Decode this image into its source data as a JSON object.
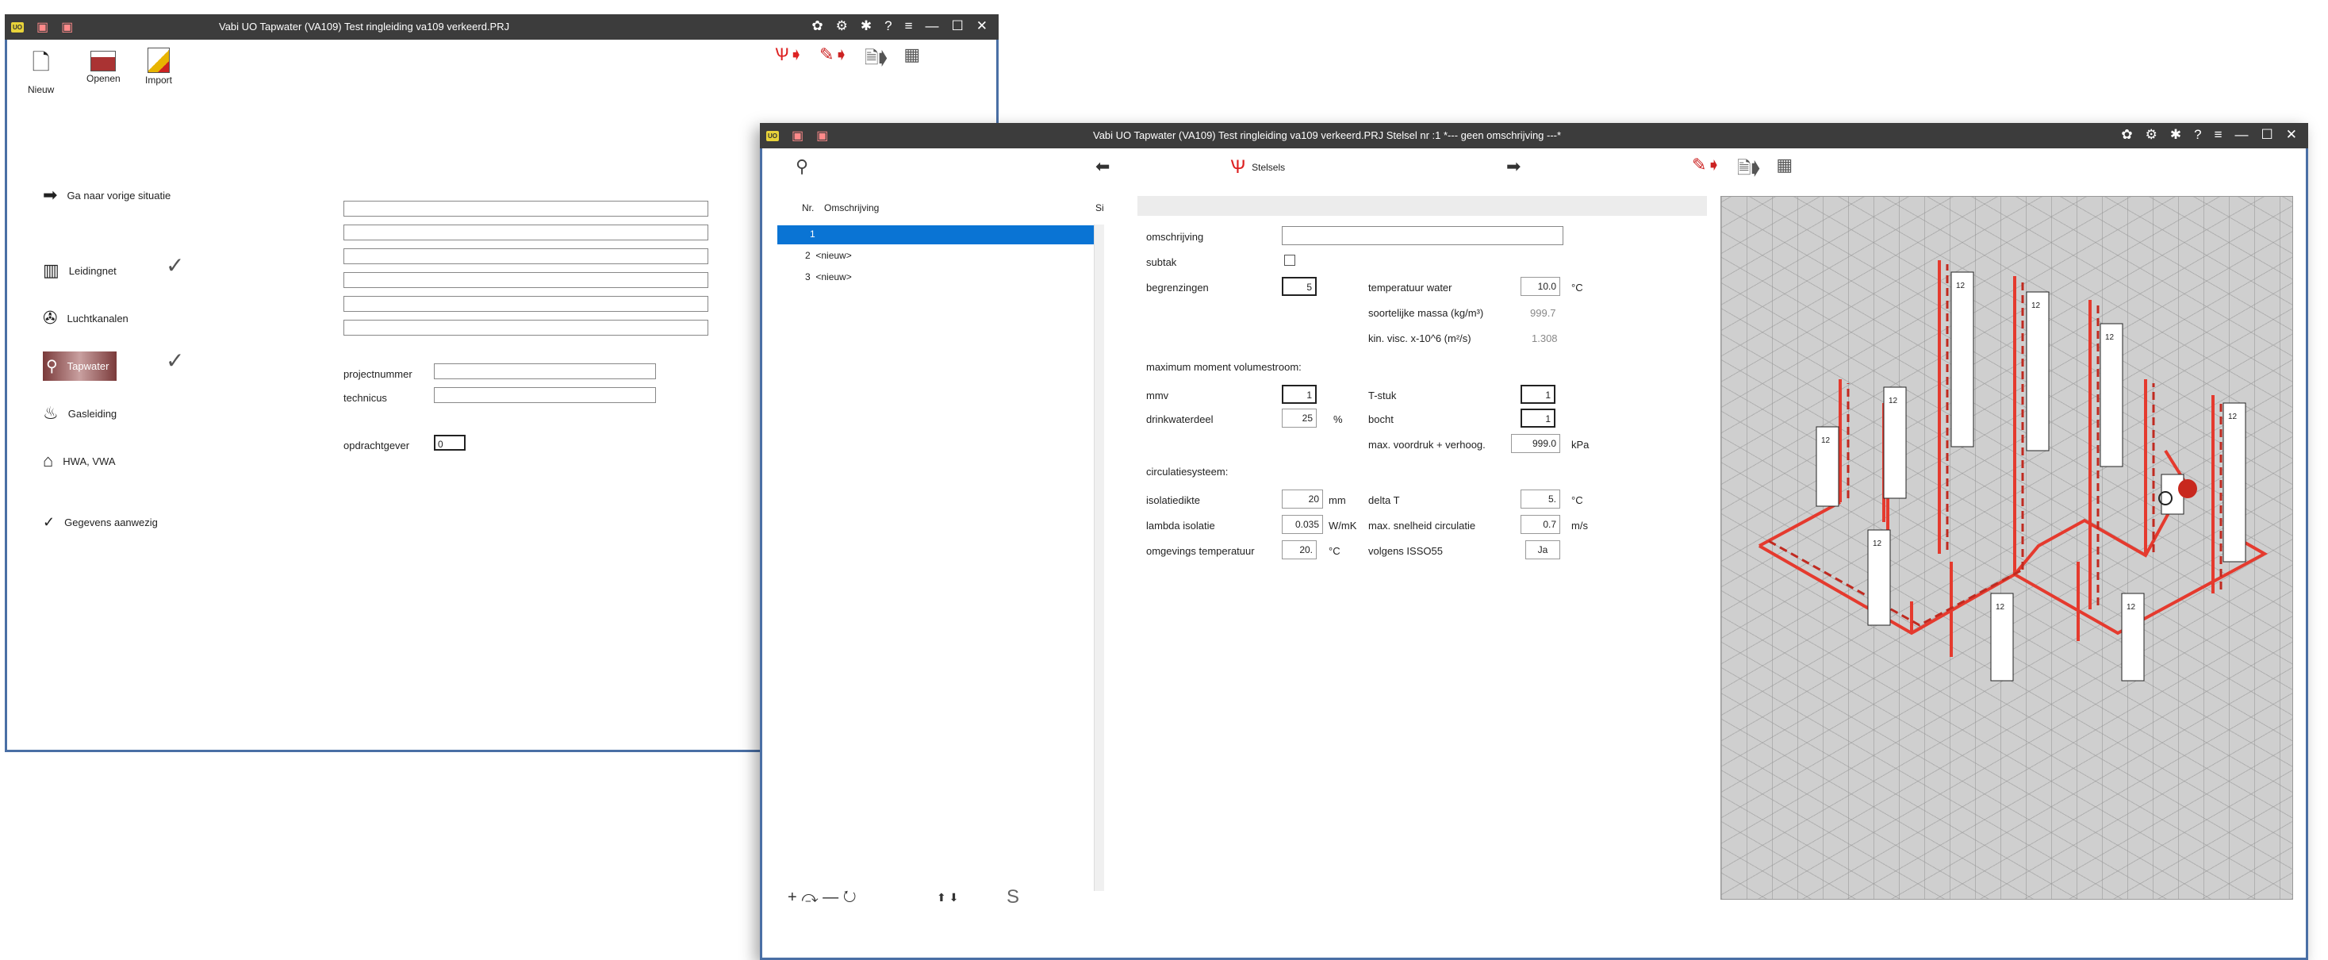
{
  "win1": {
    "title": "Vabi UO Tapwater (VA109)  Test ringleiding va109 verkeerd.PRJ",
    "toolbar": {
      "new": "Nieuw",
      "open": "Openen",
      "import": "Import"
    },
    "prev_situation": "Ga naar vorige situatie",
    "modules": [
      {
        "label": "Leidingnet",
        "checked": true,
        "icon": "radiator-icon"
      },
      {
        "label": "Luchtkanalen",
        "checked": false,
        "icon": "fan-icon"
      },
      {
        "label": "Tapwater",
        "checked": true,
        "icon": "tap-icon"
      },
      {
        "label": "Gasleiding",
        "checked": false,
        "icon": "flame-icon"
      },
      {
        "label": "HWA, VWA",
        "checked": false,
        "icon": "toilet-icon"
      }
    ],
    "data_present": "Gegevens aanwezig",
    "projectnummer_label": "projectnummer",
    "technicus_label": "technicus",
    "opdrachtgever_label": "opdrachtgever",
    "opdrachtgever_value": "0"
  },
  "win2": {
    "title": "Vabi UO Tapwater (VA109)  Test ringleiding va109 verkeerd.PRJ     Stelsel nr  :1  *--- geen omschrijving ---*",
    "tab_label": "Stelsels",
    "list": {
      "col_nr": "Nr.",
      "col_desc": "Omschrijving",
      "col_s": "Si",
      "rows": [
        {
          "nr": "1",
          "desc": ""
        },
        {
          "nr": "2",
          "desc": "<nieuw>"
        },
        {
          "nr": "3",
          "desc": "<nieuw>"
        }
      ]
    },
    "form": {
      "omschrijving_label": "omschrijving",
      "subtak_label": "subtak",
      "begrenzingen_label": "begrenzingen",
      "begrenzingen_value": "5",
      "temp_water_label": "temperatuur water",
      "temp_water_value": "10.0",
      "temp_water_unit": "°C",
      "soort_massa_label": "soortelijke massa (kg/m³)",
      "soort_massa_value": "999.7",
      "kin_visc_label": "kin. visc. x-10^6 (m²/s)",
      "kin_visc_value": "1.308",
      "max_moment_label": "maximum moment volumestroom:",
      "mmv_label": "mmv",
      "mmv_value": "1",
      "tstuk_label": "T-stuk",
      "tstuk_value": "1",
      "drinkwaterdeel_label": "drinkwaterdeel",
      "drinkwaterdeel_value": "25",
      "drinkwaterdeel_unit": "%",
      "bocht_label": "bocht",
      "bocht_value": "1",
      "max_voordruk_label": "max. voordruk + verhoog.",
      "max_voordruk_value": "999.0",
      "max_voordruk_unit": "kPa",
      "circ_label": "circulatiesysteem:",
      "isolatiedikte_label": "isolatiedikte",
      "isolatiedikte_value": "20",
      "isolatiedikte_unit": "mm",
      "delta_t_label": "delta T",
      "delta_t_value": "5.",
      "delta_t_unit": "°C",
      "lambda_label": "lambda isolatie",
      "lambda_value": "0.035",
      "lambda_unit": "W/mK",
      "max_snelheid_label": "max. snelheid circulatie",
      "max_snelheid_value": "0.7",
      "max_snelheid_unit": "m/s",
      "omgev_label": "omgevings temperatuur",
      "omgev_value": "20.",
      "omgev_unit": "°C",
      "isso_label": "volgens ISSO55",
      "isso_value": "Ja"
    },
    "bottom_icons": "+ ⤼ — ↻",
    "bottom_s": "S",
    "drawing_label": "12"
  }
}
